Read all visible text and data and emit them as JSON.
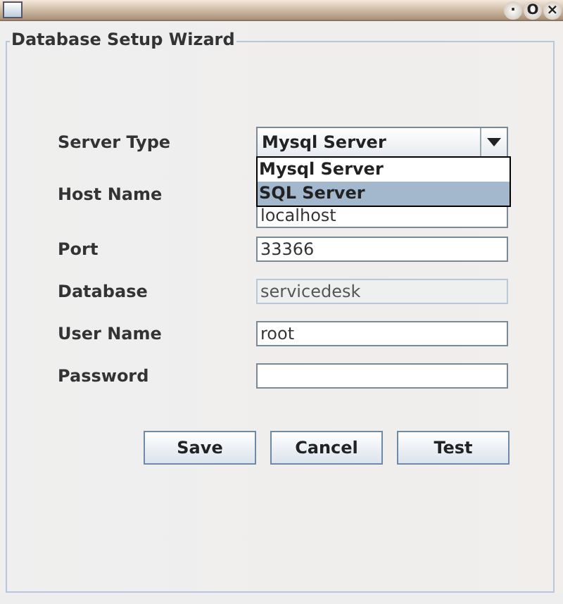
{
  "window": {
    "title_bar_buttons": [
      "·",
      "O",
      "×"
    ]
  },
  "group": {
    "title": "Database Setup Wizard"
  },
  "fields": [
    {
      "kind": "dropdown",
      "label": "Server Type",
      "value": "Mysql Server",
      "expanded": true,
      "options": [
        {
          "label": "Mysql Server",
          "highlighted": false
        },
        {
          "label": "SQL Server",
          "highlighted": true
        }
      ]
    },
    {
      "kind": "text",
      "label": "Host Name",
      "value": "localhost",
      "disabled": false
    },
    {
      "kind": "text",
      "label": "Port",
      "value": "33366",
      "disabled": false
    },
    {
      "kind": "text",
      "label": "Database",
      "value": "servicedesk",
      "disabled": true
    },
    {
      "kind": "text",
      "label": "User Name",
      "value": "root",
      "disabled": false
    },
    {
      "kind": "text",
      "label": "Password",
      "disabled": false
    }
  ],
  "buttons": [
    "Save",
    "Cancel",
    "Test"
  ]
}
